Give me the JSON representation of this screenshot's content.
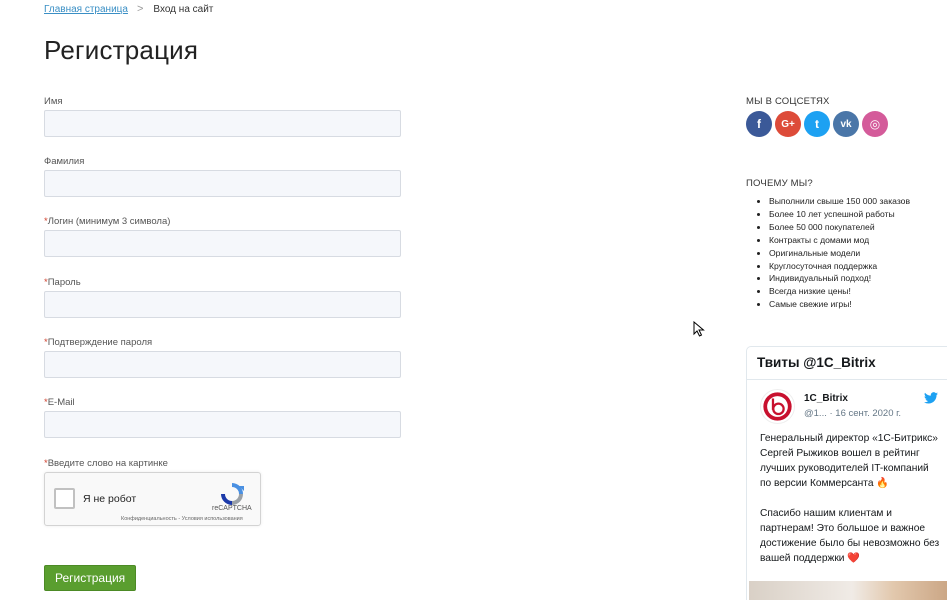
{
  "breadcrumb": {
    "home": "Главная страница",
    "separator": ">",
    "current": "Вход на сайт"
  },
  "page_title": "Регистрация",
  "form": {
    "fields": [
      {
        "label": "Имя",
        "required": false,
        "value": ""
      },
      {
        "label": "Фамилия",
        "required": false,
        "value": ""
      },
      {
        "label": "Логин (минимум 3 символа)",
        "required": true,
        "value": ""
      },
      {
        "label": "Пароль",
        "required": true,
        "value": ""
      },
      {
        "label": "Подтверждение пароля",
        "required": true,
        "value": ""
      },
      {
        "label": "E-Mail",
        "required": true,
        "value": ""
      }
    ],
    "required_mark": "*",
    "captcha_label": "Введите слово на картинке",
    "recaptcha": {
      "text": "Я не робот",
      "brand": "reCAPTCHA",
      "legal": "Конфиденциальность - Условия использования"
    },
    "submit_label": "Регистрация"
  },
  "sidebar": {
    "social_heading": "МЫ В СОЦСЕТЯХ",
    "social": [
      {
        "name": "facebook-icon",
        "glyph": "f",
        "color": "#3b5998"
      },
      {
        "name": "google-plus-icon",
        "glyph": "G+",
        "color": "#dd4b39"
      },
      {
        "name": "twitter-icon",
        "glyph": "t",
        "color": "#1da1f2"
      },
      {
        "name": "vk-icon",
        "glyph": "vk",
        "color": "#4a76a8"
      },
      {
        "name": "instagram-icon",
        "glyph": "◎",
        "color": "#d45b9a"
      }
    ],
    "why_heading": "ПОЧЕМУ МЫ?",
    "why_items": [
      "Выполнили свыше 150 000 заказов",
      "Более 10 лет успешной работы",
      "Более 50 000 покупателей",
      "Контракты с домами мод",
      "Оригинальные модели",
      "Круглосуточная поддержка",
      "Индивидуальный подход!",
      "Всегда низкие цены!",
      "Самые свежие игры!"
    ]
  },
  "twitter": {
    "title": "Твиты @1C_Bitrix",
    "name": "1C_Bitrix",
    "handle": "@1... · 16 сент. 2020 г.",
    "text": "Генеральный директор «1С-Битрикс» Сергей Рыжиков вошел в рейтинг лучших руководителей IT-компаний по версии Коммерсанта 🔥\n\nСпасибо нашим клиентам и партнерам! Это большое и важное достижение было бы невозможно без вашей поддержки ❤️"
  }
}
